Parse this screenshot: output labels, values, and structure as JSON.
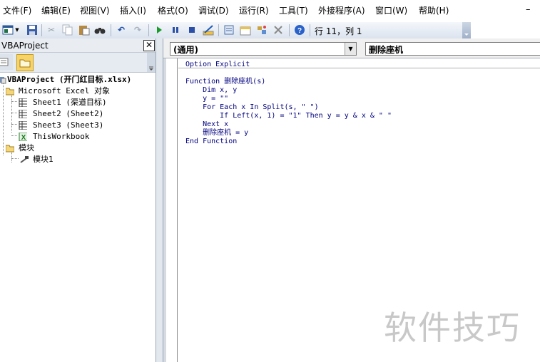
{
  "menu": {
    "items": [
      "文件(F)",
      "编辑(E)",
      "视图(V)",
      "插入(I)",
      "格式(O)",
      "调试(D)",
      "运行(R)",
      "工具(T)",
      "外接程序(A)",
      "窗口(W)",
      "帮助(H)"
    ],
    "minimize": "–"
  },
  "toolbar": {
    "cursor_position": "行 11，列 1"
  },
  "project": {
    "title": "VBAProject",
    "close": "✕",
    "root": "VBAProject (开门红目标.xlsx)",
    "excel_objects_folder": "Microsoft Excel 对象",
    "sheets": [
      "Sheet1 (渠道目标)",
      "Sheet2 (Sheet2)",
      "Sheet3 (Sheet3)",
      "ThisWorkbook"
    ],
    "modules_folder": "模块",
    "modules": [
      "模块1"
    ]
  },
  "code": {
    "object_combo": "(通用)",
    "procedure_combo": "删除座机",
    "lines": [
      "Option Explicit",
      "",
      "Function 删除座机(s)",
      "    Dim x, y",
      "    y = \"\"",
      "    For Each x In Split(s, \" \")",
      "        If Left(x, 1) = \"1\" Then y = y & x & \" \"",
      "    Next x",
      "    删除座机 = y",
      "End Function"
    ]
  },
  "watermark": "软件技巧",
  "colors": {
    "code_text": "#00007f",
    "accent": "#dbe3ee"
  }
}
